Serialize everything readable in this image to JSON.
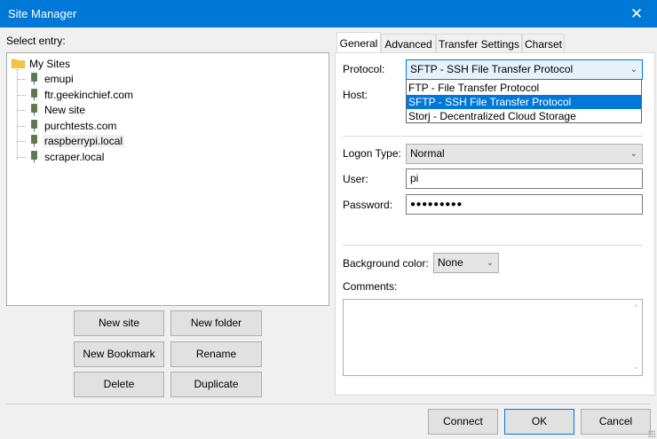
{
  "window": {
    "title": "Site Manager",
    "close_icon": "close-icon"
  },
  "left": {
    "select_entry_label": "Select entry:",
    "tree": {
      "root": {
        "label": "My Sites",
        "icon": "folder-icon"
      },
      "sites": [
        {
          "label": "emupi",
          "icon": "server-icon",
          "selected": false
        },
        {
          "label": "ftr.geekinchief.com",
          "icon": "server-icon",
          "selected": false
        },
        {
          "label": "New site",
          "icon": "server-icon",
          "selected": false
        },
        {
          "label": "purchtests.com",
          "icon": "server-icon",
          "selected": false
        },
        {
          "label": "raspberrypi.local",
          "icon": "server-icon",
          "selected": true
        },
        {
          "label": "scraper.local",
          "icon": "server-icon",
          "selected": false
        }
      ]
    },
    "buttons": {
      "new_site": "New site",
      "new_folder": "New folder",
      "new_bookmark": "New Bookmark",
      "rename": "Rename",
      "delete": "Delete",
      "duplicate": "Duplicate"
    }
  },
  "tabs": {
    "items": [
      {
        "label": "General",
        "active": true
      },
      {
        "label": "Advanced",
        "active": false
      },
      {
        "label": "Transfer Settings",
        "active": false
      },
      {
        "label": "Charset",
        "active": false
      }
    ]
  },
  "general": {
    "protocol_label": "Protocol:",
    "protocol_value": "SFTP - SSH File Transfer Protocol",
    "protocol_options": [
      {
        "label": "FTP - File Transfer Protocol",
        "selected": false
      },
      {
        "label": "SFTP - SSH File Transfer Protocol",
        "selected": true
      },
      {
        "label": "Storj - Decentralized Cloud Storage",
        "selected": false
      }
    ],
    "host_label": "Host:",
    "logon_type_label": "Logon Type:",
    "logon_type_value": "Normal",
    "user_label": "User:",
    "user_value": "pi",
    "password_label": "Password:",
    "password_value": "●●●●●●●●●",
    "background_color_label": "Background color:",
    "background_color_value": "None",
    "comments_label": "Comments:",
    "comments_value": ""
  },
  "footer": {
    "connect": "Connect",
    "ok": "OK",
    "cancel": "Cancel"
  },
  "colors": {
    "accent": "#0078d7",
    "window_bg": "#f0f0f0",
    "folder": "#f4c342",
    "server": "#5a7a4a"
  }
}
